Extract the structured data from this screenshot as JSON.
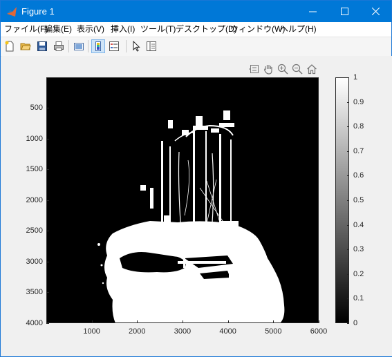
{
  "window": {
    "title": "Figure 1",
    "controls": {
      "minimize_icon": "minimize-icon",
      "maximize_icon": "maximize-icon",
      "close_icon": "close-icon"
    }
  },
  "menubar": {
    "items": [
      {
        "label": "ファイル(F)"
      },
      {
        "label": "編集(E)"
      },
      {
        "label": "表示(V)"
      },
      {
        "label": "挿入(I)"
      },
      {
        "label": "ツール(T)"
      },
      {
        "label": "デスクトップ(D)"
      },
      {
        "label": "ウィンドウ(W)"
      },
      {
        "label": "ヘルプ(H)"
      }
    ]
  },
  "toolbar": {
    "items": [
      {
        "icon": "new-figure-icon"
      },
      {
        "icon": "open-file-icon"
      },
      {
        "icon": "save-icon"
      },
      {
        "icon": "print-icon"
      },
      {
        "icon": "link-plot-icon"
      },
      {
        "icon": "insert-colorbar-icon",
        "active": true
      },
      {
        "icon": "insert-legend-icon"
      },
      {
        "icon": "pointer-icon"
      },
      {
        "icon": "property-inspector-icon"
      }
    ]
  },
  "axes_toolbar": [
    "data-tips-icon",
    "pan-icon",
    "zoom-in-icon",
    "zoom-out-icon",
    "home-icon"
  ],
  "chart_data": {
    "type": "heatmap",
    "description_colormap": "gray",
    "x_ticks": [
      "1000",
      "2000",
      "3000",
      "4000",
      "5000",
      "6000"
    ],
    "y_ticks": [
      "500",
      "1000",
      "1500",
      "2000",
      "2500",
      "3000",
      "3500",
      "4000"
    ],
    "xlim": [
      1,
      6000
    ],
    "ylim": [
      1,
      4000
    ],
    "x_tick_values": [
      1000,
      2000,
      3000,
      4000,
      5000,
      6000
    ],
    "y_tick_values": [
      500,
      1000,
      1500,
      2000,
      2500,
      3000,
      3500,
      4000
    ],
    "colorbar": {
      "ticks": [
        "0",
        "0.1",
        "0.2",
        "0.3",
        "0.4",
        "0.5",
        "0.6",
        "0.7",
        "0.8",
        "0.9",
        "1"
      ],
      "tick_values": [
        0,
        0.1,
        0.2,
        0.3,
        0.4,
        0.5,
        0.6,
        0.7,
        0.8,
        0.9,
        1
      ],
      "range": [
        0,
        1
      ]
    }
  }
}
